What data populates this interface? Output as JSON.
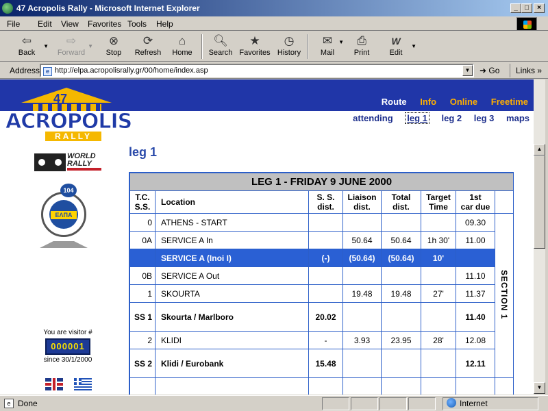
{
  "window": {
    "title": "47 Acropolis Rally - Microsoft Internet Explorer",
    "controls": {
      "minimize": "_",
      "maximize": "□",
      "close": "×"
    }
  },
  "menu": [
    "File",
    "Edit",
    "View",
    "Favorites",
    "Tools",
    "Help"
  ],
  "toolbar": {
    "back": "Back",
    "forward": "Forward",
    "stop": "Stop",
    "refresh": "Refresh",
    "home": "Home",
    "search": "Search",
    "favorites": "Favorites",
    "history": "History",
    "mail": "Mail",
    "print": "Print",
    "edit": "Edit"
  },
  "address": {
    "label": "Address",
    "url": "http://elpa.acropolisrally.gr/00/home/index.asp",
    "go": "Go",
    "links": "Links"
  },
  "site": {
    "logo": {
      "number": "47",
      "word": "ACROPOLIS",
      "sub": "RALLY"
    },
    "topnav": [
      "Route",
      "Info",
      "Online",
      "Freetime"
    ],
    "subnav": [
      "attending",
      "leg 1",
      "leg 2",
      "leg 3",
      "maps"
    ],
    "page_title": "leg 1",
    "fia": {
      "line1": "WORLD",
      "line2": "RALLY"
    },
    "elpa": {
      "badge": "104",
      "label": "ΕΛΠΑ"
    },
    "visitor": {
      "label": "You are visitor #",
      "count": "000001",
      "since": "since 30/1/2000"
    }
  },
  "table": {
    "caption": "LEG 1 - FRIDAY 9 JUNE 2000",
    "headers": {
      "tc": "T.C.",
      "ss": "S.S.",
      "location": "Location",
      "ssdist1": "S. S.",
      "ssdist2": "dist.",
      "liaison1": "Liaison",
      "liaison2": "dist.",
      "total1": "Total",
      "total2": "dist.",
      "target1": "Target",
      "target2": "Time",
      "first1": "1st",
      "first2": "car due"
    },
    "section_label": "SECTION 1",
    "rows": [
      {
        "tc": "0",
        "loc": "ATHENS - START",
        "ss": "",
        "liaison": "",
        "total": "",
        "target": "",
        "due": "09.30"
      },
      {
        "tc": "0A",
        "loc": "SERVICE A In",
        "ss": "",
        "liaison": "50.64",
        "total": "50.64",
        "target": "1h 30'",
        "due": "11.00"
      },
      {
        "tc": "",
        "loc": "SERVICE  A  (Inoi  I)",
        "ss": "(-)",
        "liaison": "(50.64)",
        "total": "(50.64)",
        "target": "10'",
        "due": ""
      },
      {
        "tc": "0B",
        "loc": "SERVICE A Out",
        "ss": "",
        "liaison": "",
        "total": "",
        "target": "",
        "due": "11.10"
      },
      {
        "tc": "1",
        "loc": "SKOURTA",
        "ss": "",
        "liaison": "19.48",
        "total": "19.48",
        "target": "27'",
        "due": "11.37"
      },
      {
        "tc": "SS 1",
        "loc": "Skourta / Marlboro",
        "ss": "20.02",
        "liaison": "",
        "total": "",
        "target": "",
        "due": "11.40"
      },
      {
        "tc": "2",
        "loc": "KLIDI",
        "ss": "-",
        "liaison": "3.93",
        "total": "23.95",
        "target": "28'",
        "due": "12.08"
      },
      {
        "tc": "SS 2",
        "loc": "Klidi / Eurobank",
        "ss": "15.48",
        "liaison": "",
        "total": "",
        "target": "",
        "due": "12.11"
      }
    ]
  },
  "status": {
    "text": "Done",
    "zone": "Internet"
  }
}
